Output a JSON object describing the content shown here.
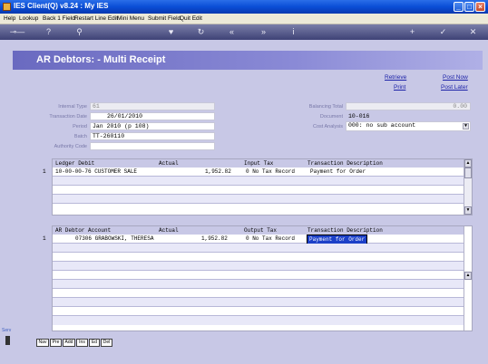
{
  "window": {
    "title": "IES Client(Q) v8.24 : My IES"
  },
  "menu": [
    "Help",
    "Lookup",
    "Back 1 Field",
    "Restart Line Edit",
    "Mini Menu",
    "Submit Field",
    "Quit Edit"
  ],
  "toolbar": {
    "icons": [
      "key-icon",
      "help-icon",
      "search-icon",
      "heart-icon",
      "refresh-icon",
      "rewind-icon",
      "fast-forward-icon",
      "info-icon",
      "plus-icon",
      "check-icon",
      "close-icon"
    ]
  },
  "banner": {
    "title": "AR Debtors: - Multi Receipt"
  },
  "links": {
    "retrieve": "Retrieve",
    "post_now": "Post Now",
    "print": "Print",
    "post_later": "Post Later"
  },
  "form": {
    "internal_type": {
      "label": "Internal Type",
      "value": "61"
    },
    "transaction_date": {
      "label": "Transaction Date",
      "value": "26/01/2010"
    },
    "period": {
      "label": "Period",
      "value": "Jan 2010 (p 108)"
    },
    "batch": {
      "label": "Batch",
      "value": "TT-260110"
    },
    "authority_code": {
      "label": "Authority Code",
      "value": ""
    },
    "balancing_total": {
      "label": "Balancing Total",
      "value": "0.00"
    },
    "document": {
      "label": "Document",
      "value": "10-016"
    },
    "cost_analysis": {
      "label": "Cost Analysis",
      "value": "000: no sub account"
    }
  },
  "ledger_grid": {
    "headers": {
      "account": "Ledger Debit",
      "actual": "Actual",
      "tax": "Input Tax",
      "desc": "Transaction Description"
    },
    "rows": [
      {
        "num": "1",
        "account": "10-00-00-76 CUSTOMER SALE",
        "actual": "1,952.82",
        "tax": "0 No Tax Record",
        "desc": "Payment for Order"
      }
    ]
  },
  "debtor_grid": {
    "headers": {
      "account": "AR Debtor Account",
      "actual": "Actual",
      "tax": "Output Tax",
      "desc": "Transaction Description"
    },
    "rows": [
      {
        "num": "1",
        "account": "07306 GRABOWSKI, THERESA",
        "actual": "1,952.82",
        "tax": "0 No Tax Record",
        "desc": "Payment for Order"
      }
    ]
  },
  "bottom_buttons": [
    "Nav",
    "Pre",
    "Add",
    "Ins",
    "Ed",
    "Del"
  ],
  "side": {
    "note": "Serv"
  },
  "colors": {
    "title_bar": "#0a4ed6",
    "banner": "#6a6ac0",
    "content_bg": "#c8c8e6",
    "link": "#1c22a8",
    "highlight": "#1c40c8"
  }
}
